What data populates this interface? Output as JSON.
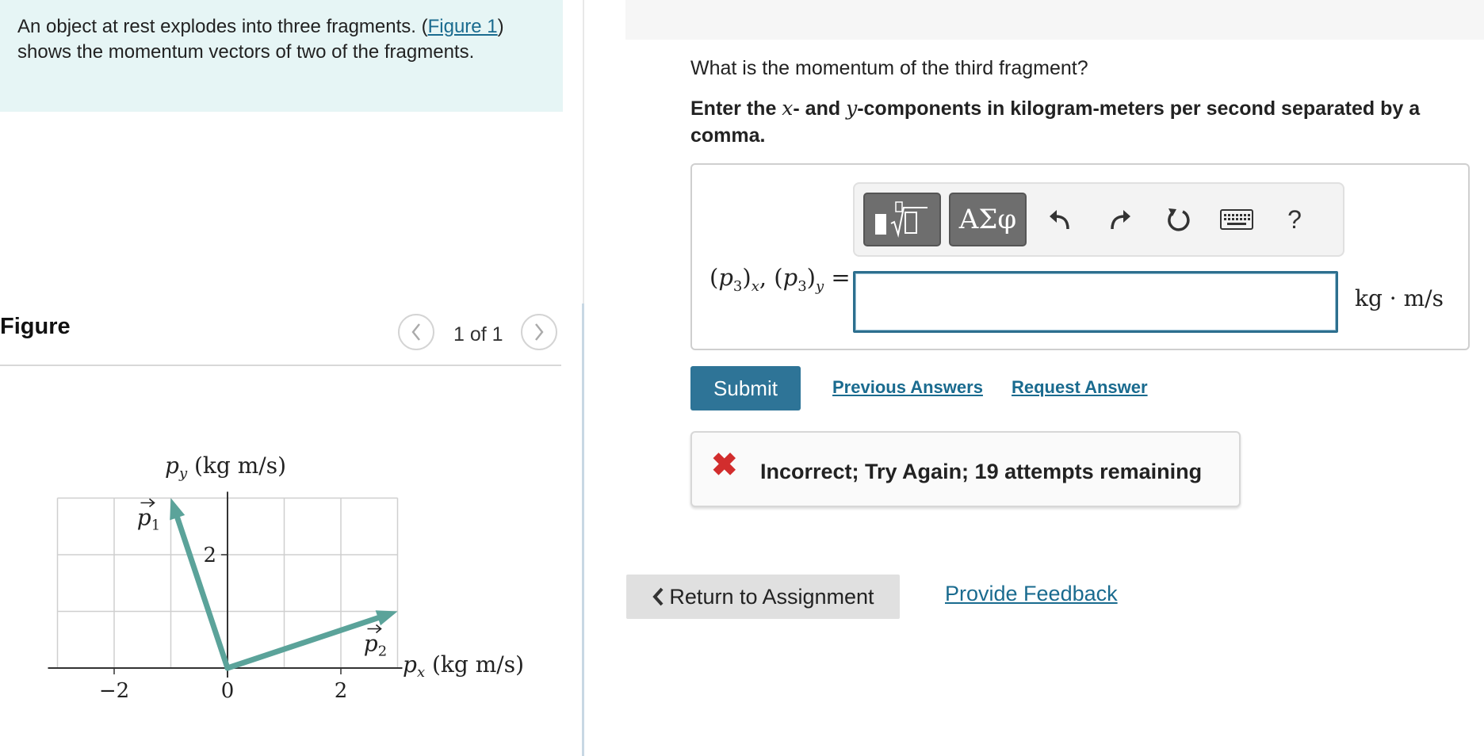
{
  "intro": {
    "text_before": "An object at rest explodes into three fragments. (",
    "figure_link": "Figure 1",
    "text_after": ") shows the momentum vectors of two of the fragments."
  },
  "figure": {
    "heading": "Figure",
    "pager": "1 of 1",
    "prev_icon": "chevron-left-icon",
    "next_icon": "chevron-right-icon"
  },
  "chart_data": {
    "type": "vector-diagram",
    "xlabel": "p",
    "xlabel_sub": "x",
    "xlabel_unit": " (kg m/s)",
    "ylabel": "p",
    "ylabel_sub": "y",
    "ylabel_unit": " (kg m/s)",
    "xlim": [
      -3,
      3
    ],
    "ylim": [
      0,
      3
    ],
    "x_ticks": [
      "−2",
      "0",
      "2"
    ],
    "y_ticks": [
      "2"
    ],
    "grid": true,
    "vectors": [
      {
        "label": "p",
        "label_sub": "1",
        "x": -1,
        "y": 3
      },
      {
        "label": "p",
        "label_sub": "2",
        "x": 3,
        "y": 1
      }
    ],
    "arrow_color": "#5ba39a"
  },
  "question": {
    "prompt": "What is the momentum of the third fragment?",
    "instruction_1": "Enter the ",
    "instruction_x": "x",
    "instruction_2": "- and ",
    "instruction_y": "y",
    "instruction_3": "-components in kilogram-meters per second separated by a comma."
  },
  "toolbar": {
    "greek_label": "ΑΣφ",
    "help_label": "?",
    "icons": [
      "templates-icon",
      "undo-icon",
      "redo-icon",
      "reset-icon",
      "keyboard-icon"
    ]
  },
  "answer": {
    "label_p": "p",
    "label_3": "3",
    "label_x": "x",
    "label_y": "y",
    "value": "",
    "unit": "kg · m/s"
  },
  "actions": {
    "submit": "Submit",
    "previous_answers": "Previous Answers",
    "request_answer": "Request Answer"
  },
  "feedback": {
    "icon": "x-mark-icon",
    "message": "Incorrect; Try Again; 19 attempts remaining"
  },
  "footer": {
    "return": "Return to Assignment",
    "provide_feedback": "Provide Feedback"
  },
  "colors": {
    "accent": "#2e7497",
    "link": "#1a6b8f",
    "error": "#d22d2d",
    "intro_bg": "#e6f5f5"
  }
}
